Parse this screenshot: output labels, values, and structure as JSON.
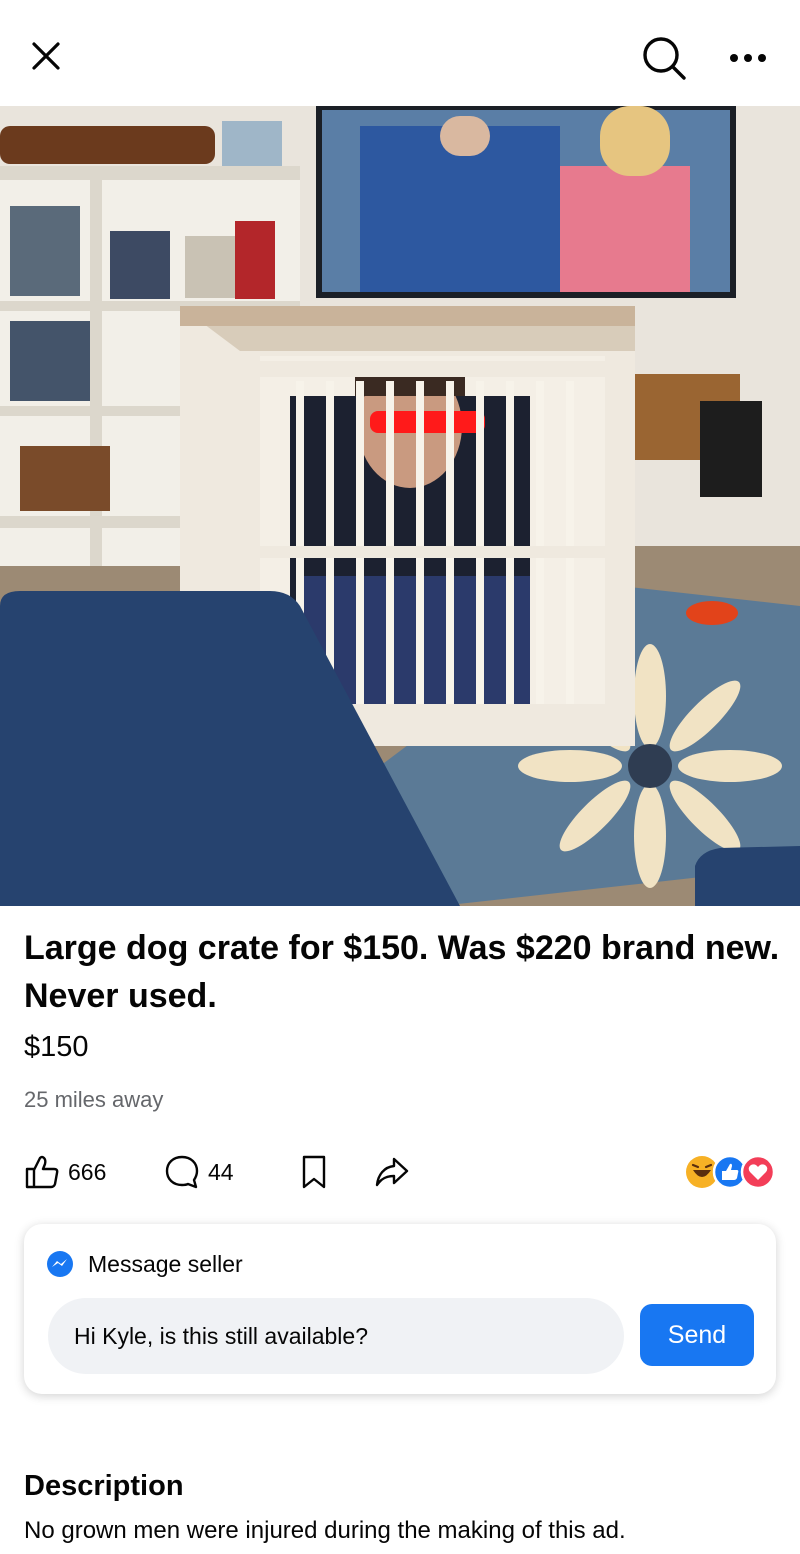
{
  "header": {
    "close_icon": "close-icon",
    "search_icon": "search-icon",
    "more_icon": "more-options-icon"
  },
  "listing": {
    "title": "Large dog crate for $150. Was $220 brand new. Never used.",
    "price": "$150",
    "distance": "25 miles away"
  },
  "engagement": {
    "likes": "666",
    "comments": "44",
    "reactions": [
      "haha",
      "like",
      "love"
    ]
  },
  "message": {
    "header_label": "Message seller",
    "input_value": "Hi Kyle, is this still available?",
    "send_label": "Send"
  },
  "description": {
    "heading": "Description",
    "text": "No grown men were injured during the making of this ad."
  },
  "colors": {
    "accent": "#1877f2",
    "secondary_text": "#65676b",
    "input_bg": "#f0f2f5",
    "love": "#f33e58",
    "haha": "#f7b125"
  }
}
